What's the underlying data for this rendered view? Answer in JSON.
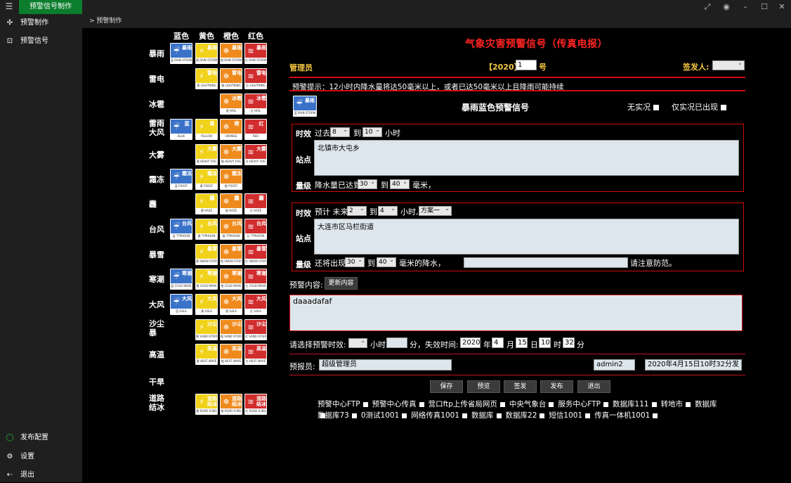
{
  "app": {
    "title_tab": "预警信号制作",
    "breadcrumb": "> 预警制作"
  },
  "sidebar": {
    "top": [
      {
        "label": "预警制作",
        "icon": "compose-icon"
      },
      {
        "label": "预警信号",
        "icon": "signal-icon"
      }
    ],
    "bottom": [
      {
        "label": "发布配置",
        "icon": "radio-icon"
      },
      {
        "label": "设置",
        "icon": "gear-icon"
      },
      {
        "label": "退出",
        "icon": "exit-icon"
      }
    ]
  },
  "grid": {
    "col_headers": [
      "蓝色",
      "黄色",
      "橙色",
      "红色"
    ],
    "rows": [
      {
        "label": "暴雨",
        "signals": [
          {
            "level": "b",
            "cn": "暴雨",
            "sub": "蓝 RAIN STORM"
          },
          {
            "level": "y",
            "cn": "暴雨",
            "sub": "黄 RAIN STORM"
          },
          {
            "level": "o",
            "cn": "暴雨",
            "sub": "橙 RAIN STORM"
          },
          {
            "level": "r",
            "cn": "暴雨",
            "sub": "红 RAIN STORM"
          }
        ]
      },
      {
        "label": "雷电",
        "signals": [
          null,
          {
            "level": "y",
            "cn": "雷电",
            "sub": "黄 LIGHTNING"
          },
          {
            "level": "o",
            "cn": "雷电",
            "sub": "橙 LIGHTNING"
          },
          {
            "level": "r",
            "cn": "雷电",
            "sub": "红 LIGHTNING"
          }
        ]
      },
      {
        "label": "冰雹",
        "signals": [
          null,
          null,
          {
            "level": "o",
            "cn": "冰雹",
            "sub": "橙 HAIL"
          },
          {
            "level": "r",
            "cn": "冰雹",
            "sub": "红 HAIL"
          }
        ]
      },
      {
        "label": "雷雨大风",
        "signals": [
          {
            "level": "b",
            "cn": "蓝",
            "sub": "BLUE"
          },
          {
            "level": "y",
            "cn": "黄",
            "sub": "YELLOW"
          },
          {
            "level": "o",
            "cn": "橙",
            "sub": "ORANGE"
          },
          {
            "level": "r",
            "cn": "红",
            "sub": "RED"
          }
        ]
      },
      {
        "label": "大雾",
        "signals": [
          null,
          {
            "level": "y",
            "cn": "大雾",
            "sub": "黄 HEAVY FOG"
          },
          {
            "level": "o",
            "cn": "大雾",
            "sub": "橙 HEAVY FOG"
          },
          {
            "level": "r",
            "cn": "大雾",
            "sub": "红 HEAVY FOG"
          }
        ]
      },
      {
        "label": "霜冻",
        "signals": [
          {
            "level": "b",
            "cn": "霜冻",
            "sub": "蓝 FROST"
          },
          {
            "level": "y",
            "cn": "霜冻",
            "sub": "黄 FROST"
          },
          {
            "level": "o",
            "cn": "霜冻",
            "sub": "橙 FROST"
          },
          null
        ]
      },
      {
        "label": "霾",
        "signals": [
          null,
          {
            "level": "y",
            "cn": "霾",
            "sub": "黄 HAZE"
          },
          {
            "level": "o",
            "cn": "霾",
            "sub": "橙 HAZE"
          },
          {
            "level": "r",
            "cn": "霾",
            "sub": "红 HAZE"
          }
        ]
      },
      {
        "label": "台风",
        "signals": [
          {
            "level": "b",
            "cn": "台风",
            "sub": "蓝 TYPHOON"
          },
          {
            "level": "y",
            "cn": "台风",
            "sub": "黄 TYPHOON"
          },
          {
            "level": "o",
            "cn": "台风",
            "sub": "橙 TYPHOON"
          },
          {
            "level": "r",
            "cn": "台风",
            "sub": "红 TYPHOON"
          }
        ]
      },
      {
        "label": "暴雪",
        "signals": [
          null,
          {
            "level": "y",
            "cn": "暴雪",
            "sub": "黄 SNOW STORM"
          },
          {
            "level": "o",
            "cn": "暴雪",
            "sub": "橙 SNOW STORM"
          },
          {
            "level": "r",
            "cn": "暴雪",
            "sub": "红 SNOW STORM"
          }
        ]
      },
      {
        "label": "寒潮",
        "signals": [
          {
            "level": "b",
            "cn": "寒潮",
            "sub": "蓝 COLD WAVE"
          },
          {
            "level": "y",
            "cn": "寒潮",
            "sub": "黄 COLD WAVE"
          },
          {
            "level": "o",
            "cn": "寒潮",
            "sub": "橙 COLD WAVE"
          },
          {
            "level": "r",
            "cn": "寒潮",
            "sub": "红 COLD WAVE"
          }
        ]
      },
      {
        "label": "大风",
        "signals": [
          {
            "level": "b",
            "cn": "大风",
            "sub": "蓝 GALE"
          },
          {
            "level": "y",
            "cn": "大风",
            "sub": "黄 GALE"
          },
          {
            "level": "o",
            "cn": "大风",
            "sub": "橙 GALE"
          },
          {
            "level": "r",
            "cn": "大风",
            "sub": "红 GALE"
          }
        ]
      },
      {
        "label": "沙尘暴",
        "signals": [
          null,
          {
            "level": "y",
            "cn": "沙尘",
            "sub": "黄 SAND STORM"
          },
          {
            "level": "o",
            "cn": "沙尘",
            "sub": "橙 SAND STORM"
          },
          {
            "level": "r",
            "cn": "沙尘",
            "sub": "红 SAND STORM"
          }
        ]
      },
      {
        "label": "高温",
        "signals": [
          null,
          {
            "level": "y",
            "cn": "高温",
            "sub": "黄 HEAT WAVE"
          },
          {
            "level": "o",
            "cn": "高温",
            "sub": "橙 HEAT WAVE"
          },
          {
            "level": "r",
            "cn": "高温",
            "sub": "红 HEAT WAVE"
          }
        ]
      },
      {
        "label": "干旱",
        "signals": [
          null,
          null,
          null,
          null
        ]
      },
      {
        "label": "道路结冰",
        "signals": [
          null,
          {
            "level": "y",
            "cn": "道路结冰",
            "sub": "黄 ROAD ICING"
          },
          {
            "level": "o",
            "cn": "道路结冰",
            "sub": "橙 ROAD ICING"
          },
          {
            "level": "r",
            "cn": "道路结冰",
            "sub": "红 ROAD ICING"
          }
        ]
      }
    ]
  },
  "form": {
    "title": "气象灾害预警信号（传真电报）",
    "admin": "管理员",
    "year_label": "【2020】",
    "number_value": "1",
    "number_suffix": "号",
    "signer_label": "签发人:",
    "hint": "预警提示：12小时内降水量将达50毫米以上，或者已达50毫米以上且降雨可能持续",
    "signal_name": "暴雨蓝色预警信号",
    "no_live": "无实况",
    "live_only": "仅实况已出现",
    "box1": {
      "shixiao": "时效",
      "past": "过去",
      "from": "8",
      "to_label": "到",
      "to": "10",
      "unit": "小时",
      "zhandian": "站点",
      "station": "北镇市大屯乡",
      "liangji": "量级",
      "amount_prefix": "降水量已达到",
      "a_from": "30",
      "a_to": "40",
      "a_unit": "毫米，"
    },
    "box2": {
      "shixiao": "时效",
      "forecast": "预计 未来",
      "from": "2",
      "to_label": "到",
      "to": "4",
      "unit": "小时,",
      "plan": "方案一",
      "zhandian": "站点",
      "station": "大连市区马栏街道",
      "liangji": "量级",
      "amount_prefix": "还将出现",
      "a_from": "30",
      "a_to": "40",
      "a_unit": "毫米的降水，",
      "tail": "请注意防范。"
    },
    "content_label": "预警内容:",
    "update_btn": "更新内容",
    "content": "daaadafaf",
    "validity_label": "请选择预警时效:",
    "hour_label": "小时",
    "min_label": "分，失效时间:",
    "exp": {
      "year": "2020",
      "year_l": "年",
      "month": "4",
      "month_l": "月",
      "day": "15",
      "day_l": "日",
      "hour": "10",
      "hour_l": "时",
      "min": "32",
      "min_l": "分"
    },
    "reporter_label": "预报员:",
    "reporter": "超级管理员",
    "user": "admin2",
    "publish_time": "2020年4月15日10时32分发布",
    "buttons": [
      "保存",
      "预览",
      "签发",
      "发布",
      "退出"
    ],
    "targets_line1": [
      "预警中心FTP",
      "预警中心传真",
      "营口ftp上传省局网页",
      "中央气象台",
      "服务中心FTP",
      "数据库111",
      "转地市",
      "数据库"
    ],
    "targets_line2": [
      "数据库73",
      "0测试1001",
      "网络传真1001",
      "数据库",
      "数据库22",
      "短信1001",
      "传真一体机1001"
    ]
  },
  "colors": {
    "blue": "#3a72c9",
    "yellow": "#f1d21a",
    "orange": "#ef8a1d",
    "red": "#d12d2d",
    "accent_green": "#0b7d2c",
    "title_red": "#ff2424"
  }
}
